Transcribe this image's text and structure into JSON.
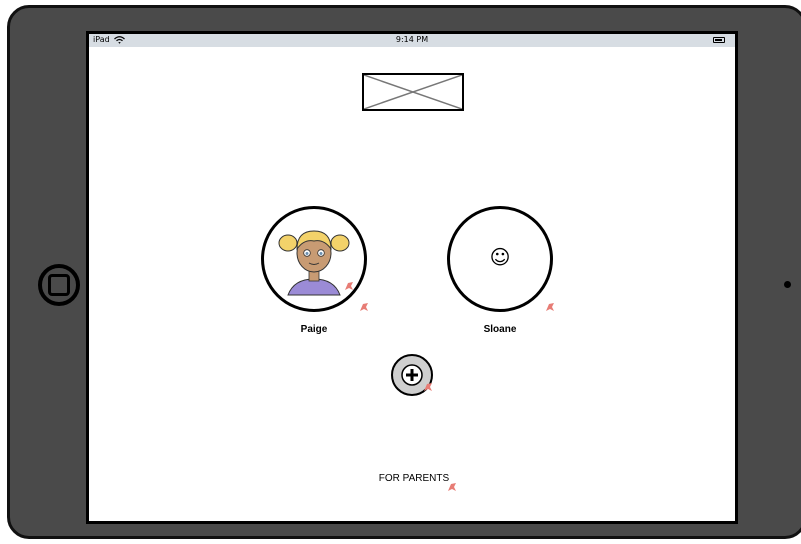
{
  "status_bar": {
    "carrier": "iPad",
    "time": "9:14 PM"
  },
  "icons": {
    "wifi": "wifi-icon",
    "battery": "battery-icon",
    "logo": "image-placeholder-icon",
    "smiley": "smiley-icon",
    "add": "plus-icon",
    "link": "link-arrow-icon",
    "home": "home-button-icon"
  },
  "profiles": [
    {
      "name": "Paige",
      "avatar": "girl-portrait"
    },
    {
      "name": "Sloane",
      "avatar": "☺"
    }
  ],
  "footer": {
    "for_parents_label": "FOR PARENTS"
  },
  "colors": {
    "device": "#4a4a4a",
    "status_bar": "#d7dde3",
    "add_button": "#cfcfcf",
    "link_marker": "#e77c75"
  }
}
